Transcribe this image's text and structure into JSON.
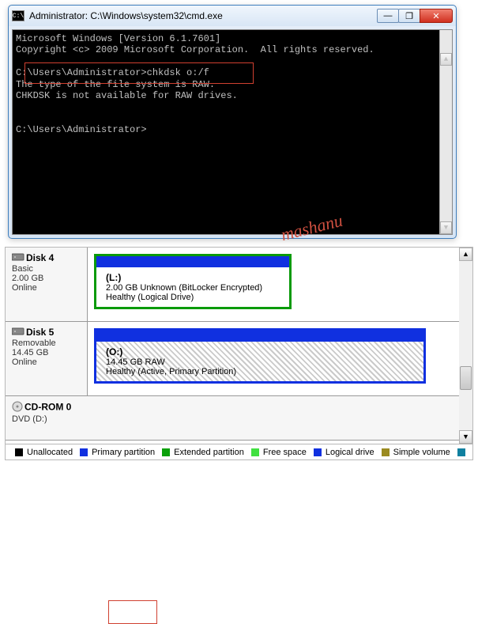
{
  "cmd": {
    "title_prefix": "Administrator: ",
    "title_path": "C:\\Windows\\system32\\cmd.exe",
    "icon_text": "C:\\",
    "lines": {
      "l1": "Microsoft Windows [Version 6.1.7601]",
      "l2": "Copyright <c> 2009 Microsoft Corporation.  All rights reserved.",
      "l3": "",
      "l4": "C:\\Users\\Administrator>chkdsk o:/f",
      "l5": "The type of the file system is RAW.",
      "l6": "CHKDSK is not available for RAW drives.",
      "l7": "",
      "l8": "",
      "l9": "C:\\Users\\Administrator>"
    },
    "buttons": {
      "min": "—",
      "max": "❐",
      "close": "✕"
    }
  },
  "watermark": "mashanu",
  "disks": {
    "d4": {
      "name": "Disk 4",
      "type": "Basic",
      "size": "2.00 GB",
      "status": "Online",
      "vol": {
        "letter": "(L:)",
        "line1": "2.00 GB Unknown (BitLocker Encrypted)",
        "line2": "Healthy (Logical Drive)"
      }
    },
    "d5": {
      "name": "Disk 5",
      "type": "Removable",
      "size": "14.45 GB",
      "status": "Online",
      "vol": {
        "letter": "(O:)",
        "line1": "14.45 GB RAW",
        "line2": "Healthy (Active, Primary Partition)"
      }
    },
    "cd": {
      "name": "CD-ROM 0",
      "type": "DVD (D:)"
    }
  },
  "legend": {
    "unalloc": "Unallocated",
    "primary": "Primary partition",
    "extended": "Extended partition",
    "free": "Free space",
    "logical": "Logical drive",
    "simple": "Simple volume"
  },
  "scroll": {
    "up": "▲",
    "down": "▼"
  }
}
